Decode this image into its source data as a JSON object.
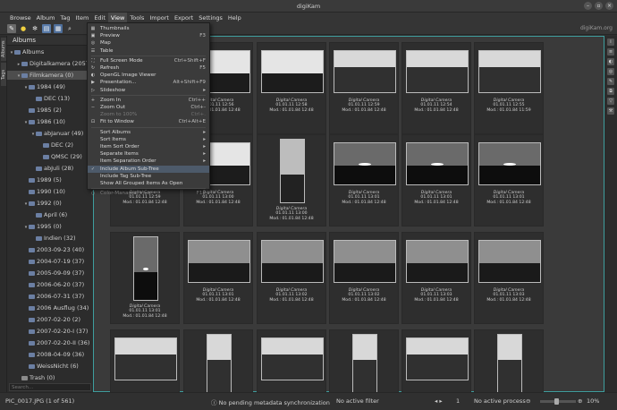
{
  "window": {
    "title": "digiKam"
  },
  "menubar": [
    "Browse",
    "Album",
    "Tag",
    "Item",
    "Edit",
    "View",
    "Tools",
    "Import",
    "Export",
    "Settings",
    "Help"
  ],
  "toolbar": {
    "brand": "digiKam.org"
  },
  "left_tabs": [
    "Albums",
    "Tags"
  ],
  "sidebar": {
    "title": "Albums",
    "search_placeholder": "Search...",
    "items": [
      {
        "label": "Albums",
        "level": 0,
        "exp": "▾"
      },
      {
        "label": "Digitalkamera (2057)",
        "level": 1,
        "exp": "▸"
      },
      {
        "label": "Filmkamera (0)",
        "level": 1,
        "exp": "▾",
        "selected": true
      },
      {
        "label": "1984 (49)",
        "level": 2,
        "exp": "▾"
      },
      {
        "label": "DEC (13)",
        "level": 3,
        "exp": ""
      },
      {
        "label": "1985 (2)",
        "level": 2,
        "exp": ""
      },
      {
        "label": "1986 (10)",
        "level": 2,
        "exp": "▾"
      },
      {
        "label": "abJanuar (49)",
        "level": 3,
        "exp": "▾"
      },
      {
        "label": "DEC (2)",
        "level": 4,
        "exp": ""
      },
      {
        "label": "QMSC (29)",
        "level": 4,
        "exp": ""
      },
      {
        "label": "abJuli (28)",
        "level": 3,
        "exp": ""
      },
      {
        "label": "1989 (5)",
        "level": 2,
        "exp": ""
      },
      {
        "label": "1990 (10)",
        "level": 2,
        "exp": ""
      },
      {
        "label": "1992 (0)",
        "level": 2,
        "exp": "▾"
      },
      {
        "label": "April (6)",
        "level": 3,
        "exp": ""
      },
      {
        "label": "1995 (0)",
        "level": 2,
        "exp": "▾"
      },
      {
        "label": "Indien (32)",
        "level": 3,
        "exp": ""
      },
      {
        "label": "2003-09-23 (40)",
        "level": 2,
        "exp": ""
      },
      {
        "label": "2004-07-19 (37)",
        "level": 2,
        "exp": ""
      },
      {
        "label": "2005-09-09 (37)",
        "level": 2,
        "exp": ""
      },
      {
        "label": "2006-06-20 (37)",
        "level": 2,
        "exp": ""
      },
      {
        "label": "2006-07-31 (37)",
        "level": 2,
        "exp": ""
      },
      {
        "label": "2006 Ausflug (34)",
        "level": 2,
        "exp": ""
      },
      {
        "label": "2007-02-20 (2)",
        "level": 2,
        "exp": ""
      },
      {
        "label": "2007-02-20-I (37)",
        "level": 2,
        "exp": ""
      },
      {
        "label": "2007-02-20-II (36)",
        "level": 2,
        "exp": ""
      },
      {
        "label": "2008-04-09 (36)",
        "level": 2,
        "exp": ""
      },
      {
        "label": "WeissNicht (6)",
        "level": 2,
        "exp": ""
      },
      {
        "label": "Trash (0)",
        "level": 1,
        "exp": ""
      }
    ]
  },
  "view_menu": {
    "items": [
      {
        "icon": "▦",
        "label": "Thumbnails",
        "shortcut": ""
      },
      {
        "icon": "▣",
        "label": "Preview",
        "shortcut": "F3"
      },
      {
        "icon": "◎",
        "label": "Map",
        "shortcut": ""
      },
      {
        "icon": "☰",
        "label": "Table",
        "shortcut": ""
      },
      {
        "sep": true
      },
      {
        "icon": "⛶",
        "label": "Full Screen Mode",
        "shortcut": "Ctrl+Shift+F"
      },
      {
        "icon": "↻",
        "label": "Refresh",
        "shortcut": "F5"
      },
      {
        "icon": "◐",
        "label": "OpenGL Image Viewer",
        "shortcut": ""
      },
      {
        "icon": "▶",
        "label": "Presentation...",
        "shortcut": "Alt+Shift+F9"
      },
      {
        "icon": "▷",
        "label": "Slideshow",
        "shortcut": "▸"
      },
      {
        "sep": true
      },
      {
        "icon": "+",
        "label": "Zoom In",
        "shortcut": "Ctrl++"
      },
      {
        "icon": "−",
        "label": "Zoom Out",
        "shortcut": "Ctrl+-"
      },
      {
        "icon": "",
        "label": "Zoom to 100%",
        "shortcut": "Ctrl+.",
        "disabled": true
      },
      {
        "icon": "⊡",
        "label": "Fit to Window",
        "shortcut": "Ctrl+Alt+E"
      },
      {
        "sep": true
      },
      {
        "icon": "",
        "label": "Sort Albums",
        "shortcut": "▸"
      },
      {
        "icon": "",
        "label": "Sort Items",
        "shortcut": "▸"
      },
      {
        "icon": "",
        "label": "Item Sort Order",
        "shortcut": "▸"
      },
      {
        "icon": "",
        "label": "Separate Items",
        "shortcut": "▸"
      },
      {
        "icon": "",
        "label": "Item Separation Order",
        "shortcut": "▸"
      },
      {
        "icon": "✓",
        "label": "Include Album Sub-Tree",
        "shortcut": "",
        "highlight": true
      },
      {
        "icon": "",
        "label": "Include Tag Sub-Tree",
        "shortcut": ""
      },
      {
        "icon": "",
        "label": "Show All Grouped Items As Open",
        "shortcut": ""
      },
      {
        "sep": true
      },
      {
        "icon": "◌",
        "label": "Color-Managed View",
        "shortcut": "F12",
        "disabled": true
      }
    ]
  },
  "thumbnails": [
    {
      "row": 0,
      "col": 0,
      "orient": "l",
      "kind": "lake",
      "t1": "Digital Camera",
      "t2": "01.01.11 12:59",
      "t3": "Mod.: 01.01.84 12:48"
    },
    {
      "row": 0,
      "col": 1,
      "orient": "l",
      "kind": "masts",
      "t1": "Digital Camera",
      "t2": "01.01.11 12:56",
      "t3": "Mod.: 01.01.84 12:48"
    },
    {
      "row": 0,
      "col": 2,
      "orient": "l",
      "kind": "masts",
      "t1": "Digital Camera",
      "t2": "01.01.11 12:58",
      "t3": "Mod.: 01.01.84 12:48"
    },
    {
      "row": 0,
      "col": 3,
      "orient": "l",
      "kind": "street",
      "t1": "Digital Camera",
      "t2": "01.01.11 12:59",
      "t3": "Mod.: 01.01.84 12:48"
    },
    {
      "row": 0,
      "col": 4,
      "orient": "l",
      "kind": "street",
      "t1": "Digital Camera",
      "t2": "01.01.11 12:54",
      "t3": "Mod.: 01.01.84 12:48"
    },
    {
      "row": 0,
      "col": 5,
      "orient": "l",
      "kind": "street",
      "t1": "Digital Camera",
      "t2": "01.01.11 12:55",
      "t3": "Mod.: 01.01.84 11:59"
    },
    {
      "row": 1,
      "col": 0,
      "orient": "l",
      "kind": "lake",
      "t1": "Digital Camera",
      "t2": "01.01.11 12:59",
      "t3": "Mod.: 01.01.84 12:48"
    },
    {
      "row": 1,
      "col": 1,
      "orient": "l",
      "kind": "lake",
      "t1": "Digital Camera",
      "t2": "01.01.11 13:00",
      "t3": "Mod.: 01.01.84 12:48"
    },
    {
      "row": 1,
      "col": 2,
      "orient": "p",
      "kind": "boats",
      "t1": "Digital Camera",
      "t2": "01.01.11 13:00",
      "t3": "Mod.: 01.01.84 12:48"
    },
    {
      "row": 1,
      "col": 3,
      "orient": "l",
      "kind": "sunset",
      "t1": "Digital Camera",
      "t2": "01.01.11 13:01",
      "t3": "Mod.: 01.01.84 12:48"
    },
    {
      "row": 1,
      "col": 4,
      "orient": "l",
      "kind": "sunset",
      "t1": "Digital Camera",
      "t2": "01.01.11 13:01",
      "t3": "Mod.: 01.01.84 12:48"
    },
    {
      "row": 1,
      "col": 5,
      "orient": "l",
      "kind": "sunset",
      "t1": "Digital Camera",
      "t2": "01.01.11 13:01",
      "t3": "Mod.: 01.01.84 12:48"
    },
    {
      "row": 2,
      "col": 0,
      "orient": "p",
      "kind": "sunset",
      "t1": "Digital Camera",
      "t2": "01.01.11 13:01",
      "t3": "Mod.: 01.01.84 12:48"
    },
    {
      "row": 2,
      "col": 1,
      "orient": "l",
      "kind": "sea",
      "t1": "Digital Camera",
      "t2": "01.01.11 13:01",
      "t3": "Mod.: 01.01.84 12:48"
    },
    {
      "row": 2,
      "col": 2,
      "orient": "l",
      "kind": "sea",
      "t1": "Digital Camera",
      "t2": "01.01.11 13:02",
      "t3": "Mod.: 01.01.84 12:48"
    },
    {
      "row": 2,
      "col": 3,
      "orient": "l",
      "kind": "sea",
      "t1": "Digital Camera",
      "t2": "01.01.11 13:02",
      "t3": "Mod.: 01.01.84 12:48"
    },
    {
      "row": 2,
      "col": 4,
      "orient": "l",
      "kind": "sea",
      "t1": "Digital Camera",
      "t2": "01.01.11 13:03",
      "t3": "Mod.: 01.01.84 12:48"
    },
    {
      "row": 2,
      "col": 5,
      "orient": "l",
      "kind": "sea",
      "t1": "Digital Camera",
      "t2": "01.01.11 13:03",
      "t3": "Mod.: 01.01.84 12:48"
    },
    {
      "row": 3,
      "col": 0,
      "orient": "l",
      "kind": "people",
      "t1": "",
      "t2": "",
      "t3": ""
    },
    {
      "row": 3,
      "col": 1,
      "orient": "p",
      "kind": "people",
      "t1": "",
      "t2": "",
      "t3": ""
    },
    {
      "row": 3,
      "col": 2,
      "orient": "l",
      "kind": "people",
      "t1": "",
      "t2": "",
      "t3": ""
    },
    {
      "row": 3,
      "col": 3,
      "orient": "p",
      "kind": "people",
      "t1": "",
      "t2": "",
      "t3": ""
    },
    {
      "row": 3,
      "col": 4,
      "orient": "l",
      "kind": "people",
      "t1": "",
      "t2": "",
      "t3": ""
    },
    {
      "row": 3,
      "col": 5,
      "orient": "p",
      "kind": "people",
      "t1": "",
      "t2": "",
      "t3": ""
    }
  ],
  "status": {
    "file": "PIC_0017.JPG (1 of 561)",
    "sync": "No pending metadata synchronization",
    "filter": "No active filter",
    "process": "No active process",
    "page": "1",
    "zoom": "10%"
  }
}
